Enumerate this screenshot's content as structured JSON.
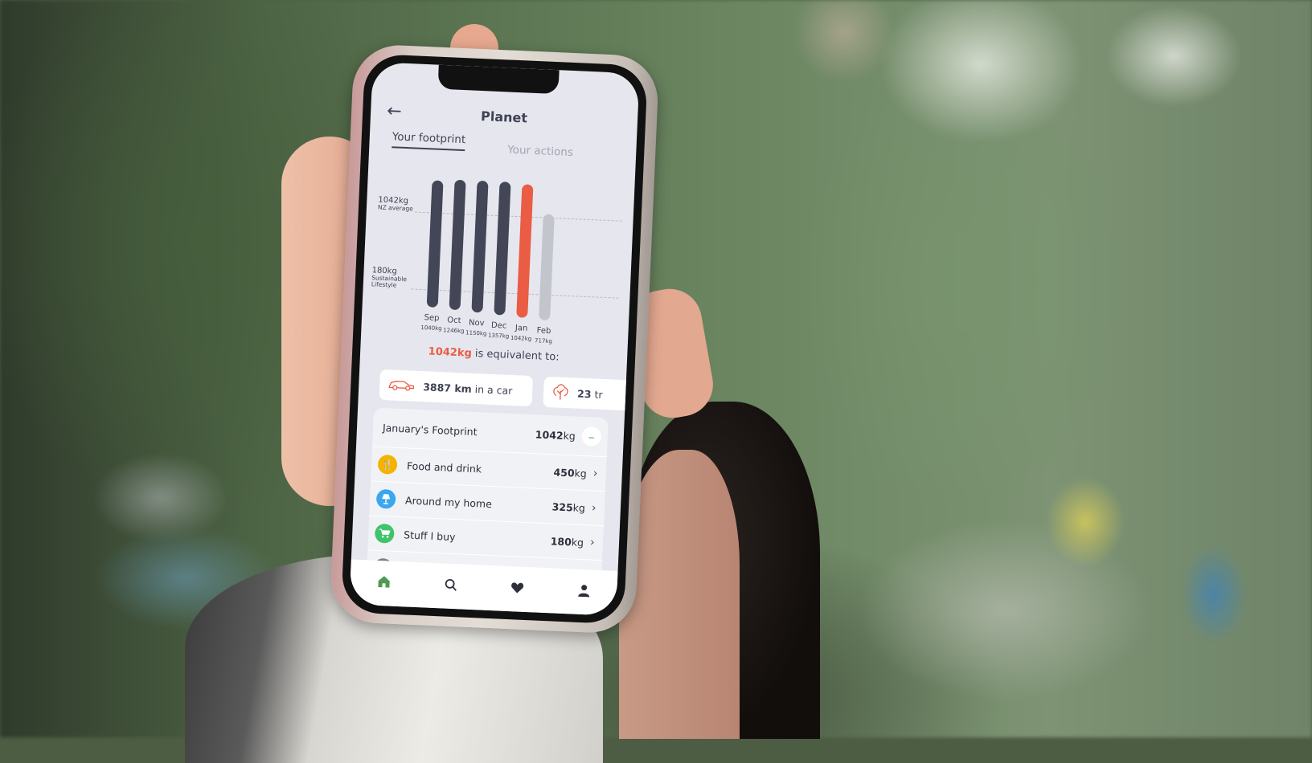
{
  "app": {
    "title": "Planet",
    "back_icon": "arrow-left-icon",
    "tabs": [
      {
        "label": "Your footprint",
        "active": true
      },
      {
        "label": "Your actions",
        "active": false
      }
    ]
  },
  "chart_data": {
    "type": "bar",
    "title": "",
    "categories": [
      "Sep",
      "Oct",
      "Nov",
      "Dec",
      "Jan",
      "Feb"
    ],
    "values": [
      1040,
      1246,
      1150,
      1357,
      1042,
      717
    ],
    "value_labels": [
      "1040kg",
      "1246kg",
      "1150kg",
      "1357kg",
      "1042kg",
      "717kg"
    ],
    "highlighted": "Jan",
    "projected": "Feb",
    "reference_lines": [
      {
        "value": 1042,
        "label": "1042kg",
        "sublabel": "NZ average"
      },
      {
        "value": 180,
        "label": "180kg",
        "sublabel": "Sustainable Lifestyle"
      }
    ],
    "xlabel": "",
    "ylabel": "",
    "colors": {
      "default": "#434656",
      "highlight": "#ea5c44",
      "projected": "#c3c5cd"
    }
  },
  "equivalent": {
    "amount": "1042kg",
    "text": " is equivalent to:",
    "cards": [
      {
        "icon": "car-icon",
        "value": "3887 km",
        "suffix": "in a car"
      },
      {
        "icon": "tree-icon",
        "value": "23",
        "suffix": "tr"
      }
    ]
  },
  "footprint": {
    "title": "January's Footprint",
    "total_value": "1042",
    "total_unit": "kg",
    "collapse_icon": "minus-icon",
    "categories": [
      {
        "label": "Food and drink",
        "value": "450",
        "unit": "kg",
        "icon": "fork-knife-icon",
        "color": "#f4b300"
      },
      {
        "label": "Around my home",
        "value": "325",
        "unit": "kg",
        "icon": "lamp-icon",
        "color": "#3aa7ef"
      },
      {
        "label": "Stuff I buy",
        "value": "180",
        "unit": "kg",
        "icon": "cart-icon",
        "color": "#3fc46b"
      }
    ]
  },
  "nav": {
    "items": [
      {
        "name": "home",
        "icon": "home-icon",
        "glyph": "⌂",
        "active": true
      },
      {
        "name": "search",
        "icon": "search-icon",
        "glyph": "⌕",
        "active": false
      },
      {
        "name": "favorites",
        "icon": "heart-icon",
        "glyph": "♥",
        "active": false
      },
      {
        "name": "profile",
        "icon": "user-icon",
        "glyph": "●",
        "active": false
      }
    ]
  },
  "colors": {
    "accent": "#ea5c44",
    "text": "#3f4254",
    "muted": "#a2a4b3",
    "active_nav": "#4e9a52"
  }
}
